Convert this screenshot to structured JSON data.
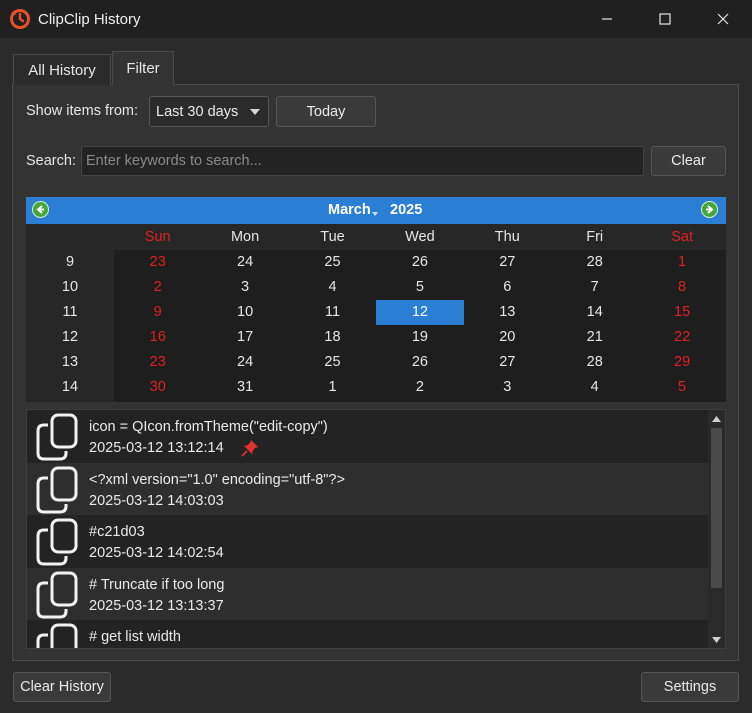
{
  "window": {
    "title": "ClipClip History",
    "app_icon": "clipclip-logo-icon",
    "controls": [
      "minimize-icon",
      "maximize-icon",
      "close-icon"
    ]
  },
  "tabs": [
    {
      "label": "All History",
      "active": false
    },
    {
      "label": "Filter",
      "active": true
    }
  ],
  "filter": {
    "show_items_label": "Show items from:",
    "range_selected": "Last 30 days",
    "today_button": "Today",
    "search_label": "Search:",
    "search_placeholder": "Enter keywords to search...",
    "search_value": "",
    "clear_button": "Clear"
  },
  "calendar": {
    "month": "March",
    "year": "2025",
    "weekday_headers": [
      "Sun",
      "Mon",
      "Tue",
      "Wed",
      "Thu",
      "Fri",
      "Sat"
    ],
    "weekend_color": "#e02020",
    "selection_color": "#2a7fd4",
    "selected_day": "12",
    "weeks": [
      {
        "week": "9",
        "days": [
          "23",
          "24",
          "25",
          "26",
          "27",
          "28",
          "1"
        ]
      },
      {
        "week": "10",
        "days": [
          "2",
          "3",
          "4",
          "5",
          "6",
          "7",
          "8"
        ]
      },
      {
        "week": "11",
        "days": [
          "9",
          "10",
          "11",
          "12",
          "13",
          "14",
          "15"
        ]
      },
      {
        "week": "12",
        "days": [
          "16",
          "17",
          "18",
          "19",
          "20",
          "21",
          "22"
        ]
      },
      {
        "week": "13",
        "days": [
          "23",
          "24",
          "25",
          "26",
          "27",
          "28",
          "29"
        ]
      },
      {
        "week": "14",
        "days": [
          "30",
          "31",
          "1",
          "2",
          "3",
          "4",
          "5"
        ]
      }
    ]
  },
  "history": [
    {
      "text": "icon = QIcon.fromTheme(\"edit-copy\")",
      "timestamp": "2025-03-12 13:12:14",
      "pinned": true
    },
    {
      "text": "<?xml version=\"1.0\" encoding=\"utf-8\"?>",
      "timestamp": "2025-03-12 14:03:03",
      "pinned": false
    },
    {
      "text": "#c21d03",
      "timestamp": "2025-03-12 14:02:54",
      "pinned": false
    },
    {
      "text": "# Truncate if too long",
      "timestamp": "2025-03-12 13:13:37",
      "pinned": false
    },
    {
      "text": "# get list width",
      "timestamp": "",
      "pinned": false
    }
  ],
  "footer": {
    "clear_history_button": "Clear History",
    "settings_button": "Settings"
  }
}
